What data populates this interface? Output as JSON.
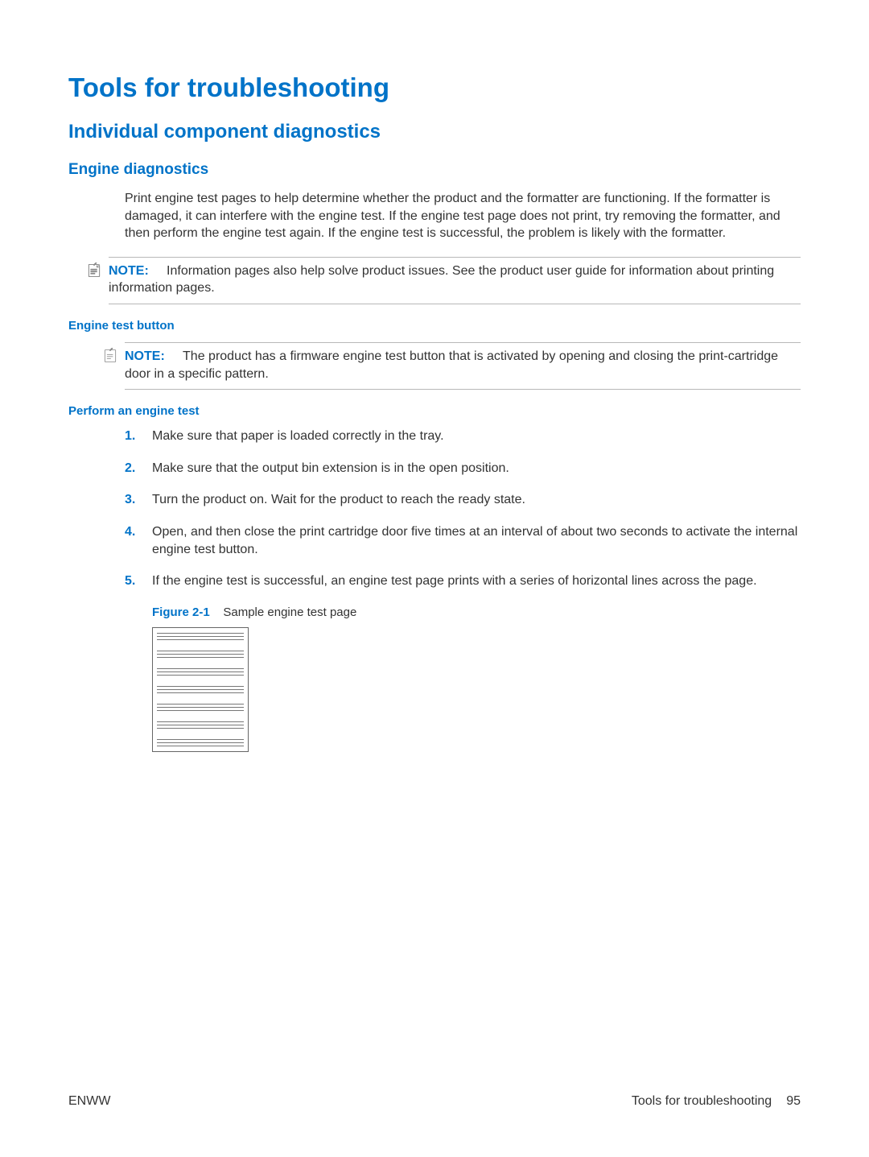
{
  "h1": "Tools for troubleshooting",
  "h2": "Individual component diagnostics",
  "h3_engine": "Engine diagnostics",
  "p_intro": "Print engine test pages to help determine whether the product and the formatter are functioning. If the formatter is damaged, it can interfere with the engine test. If the engine test page does not print, try removing the formatter, and then perform the engine test again. If the engine test is successful, the problem is likely with the formatter.",
  "note1_label": "NOTE:",
  "note1_text": "Information pages also help solve product issues. See the product user guide for information about printing information pages.",
  "h4_engine_test_button": "Engine test button",
  "note2_label": "NOTE:",
  "note2_text": "The product has a firmware engine test button that is activated by opening and closing the print-cartridge door in a specific pattern.",
  "h4_perform": "Perform an engine test",
  "steps": [
    {
      "n": "1.",
      "t": "Make sure that paper is loaded correctly in the tray."
    },
    {
      "n": "2.",
      "t": "Make sure that the output bin extension is in the open position."
    },
    {
      "n": "3.",
      "t": "Turn the product on. Wait for the product to reach the ready state."
    },
    {
      "n": "4.",
      "t": "Open, and then close the print cartridge door five times at an interval of about two seconds to activate the internal engine test button."
    },
    {
      "n": "5.",
      "t": "If the engine test is successful, an engine test page prints with a series of horizontal lines across the page."
    }
  ],
  "fig_label": "Figure 2-1",
  "fig_caption": "Sample engine test page",
  "footer_left": "ENWW",
  "footer_right_text": "Tools for troubleshooting",
  "footer_page": "95"
}
